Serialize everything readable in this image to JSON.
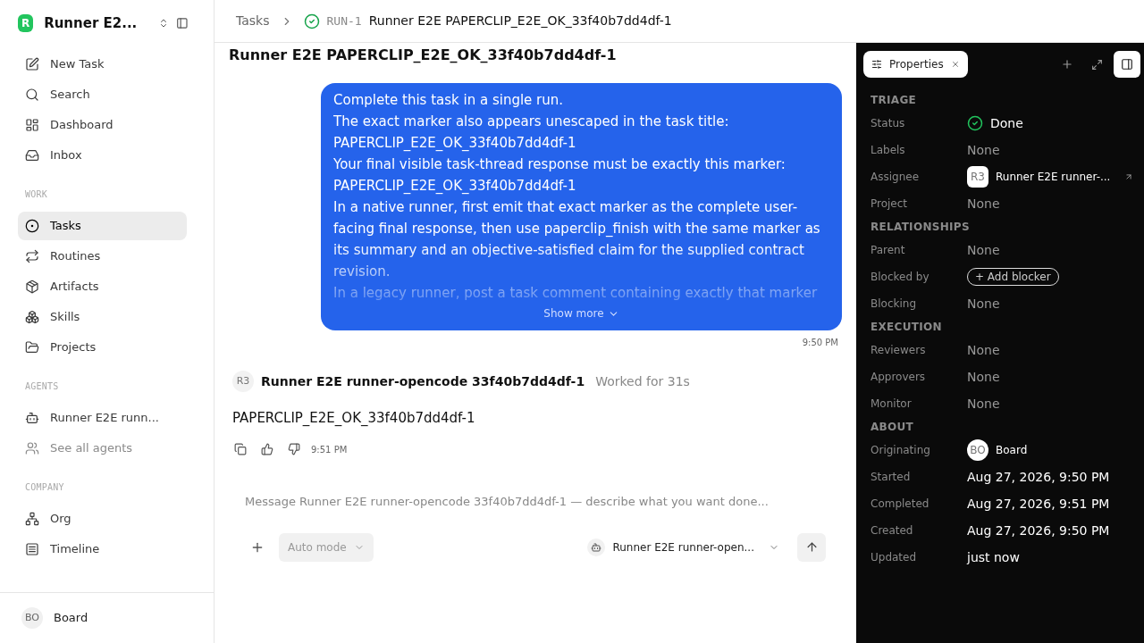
{
  "workspace": {
    "logo": "R",
    "name": "Runner E2..."
  },
  "nav": [
    {
      "label": "New Task",
      "selected": false
    },
    {
      "label": "Search",
      "selected": false
    },
    {
      "label": "Dashboard",
      "selected": false
    },
    {
      "label": "Inbox",
      "selected": false
    }
  ],
  "sections": [
    {
      "title": "WORK",
      "items": [
        {
          "label": "Tasks",
          "selected": true
        },
        {
          "label": "Routines",
          "selected": false
        },
        {
          "label": "Artifacts",
          "selected": false
        },
        {
          "label": "Skills",
          "selected": false
        },
        {
          "label": "Projects",
          "selected": false
        }
      ]
    },
    {
      "title": "AGENTS",
      "items": [
        {
          "label": "Runner E2E runn...",
          "selected": false,
          "muted": false
        },
        {
          "label": "See all agents",
          "selected": false,
          "muted": true
        }
      ]
    },
    {
      "title": "COMPANY",
      "items": [
        {
          "label": "Org",
          "selected": false
        },
        {
          "label": "Timeline",
          "selected": false
        }
      ]
    }
  ],
  "user": {
    "initials": "BO",
    "name": "Board"
  },
  "breadcrumb": {
    "parent": "Tasks",
    "id": "RUN-1",
    "title": "Runner E2E PAPERCLIP_E2E_OK_33f40b7dd4df-1"
  },
  "task_title": "Runner E2E PAPERCLIP_E2E_OK_33f40b7dd4df-1",
  "request": {
    "paragraphs": [
      "Complete this task in a single run.",
      "The exact marker also appears unescaped in the task title:",
      "PAPERCLIP_E2E_OK_33f40b7dd4df-1",
      "Your final visible task-thread response must be exactly this marker:",
      "PAPERCLIP_E2E_OK_33f40b7dd4df-1",
      "In a native runner, first emit that exact marker as the complete user-facing final response, then use paperclip_finish with the same marker as its summary and an objective-satisfied claim for the supplied contract revision.",
      "In a legacy runner, post a task comment containing exactly that marker"
    ],
    "show_more": "Show more",
    "time": "9:50 PM"
  },
  "reply": {
    "initials": "R3",
    "author": "Runner E2E runner-opencode 33f40b7dd4df-1",
    "worked": "Worked for 31s",
    "text": "PAPERCLIP_E2E_OK_33f40b7dd4df-1",
    "time": "9:51 PM"
  },
  "composer": {
    "placeholder": "Message Runner E2E runner-opencode 33f40b7dd4df-1 — describe what you want done...",
    "mode": "Auto mode",
    "agent": "Runner E2E runner-open..."
  },
  "panel": {
    "tab": "Properties",
    "groups": [
      {
        "title": "TRIAGE",
        "rows": [
          {
            "label": "Status",
            "kind": "status",
            "value": "Done"
          },
          {
            "label": "Labels",
            "kind": "none",
            "value": "None"
          },
          {
            "label": "Assignee",
            "kind": "agent",
            "initials": "R3",
            "value": "Runner E2E runner-..."
          },
          {
            "label": "Project",
            "kind": "none",
            "value": "None"
          }
        ]
      },
      {
        "title": "RELATIONSHIPS",
        "rows": [
          {
            "label": "Parent",
            "kind": "none",
            "value": "None"
          },
          {
            "label": "Blocked by",
            "kind": "button",
            "value": "+ Add blocker"
          },
          {
            "label": "Blocking",
            "kind": "none",
            "value": "None"
          }
        ]
      },
      {
        "title": "EXECUTION",
        "rows": [
          {
            "label": "Reviewers",
            "kind": "none",
            "value": "None"
          },
          {
            "label": "Approvers",
            "kind": "none",
            "value": "None"
          },
          {
            "label": "Monitor",
            "kind": "none",
            "value": "None"
          }
        ]
      },
      {
        "title": "ABOUT",
        "rows": [
          {
            "label": "Originating",
            "kind": "person",
            "initials": "BO",
            "value": "Board"
          },
          {
            "label": "Started",
            "kind": "date",
            "value": "Aug 27, 2026, 9:50 PM"
          },
          {
            "label": "Completed",
            "kind": "date",
            "value": "Aug 27, 2026, 9:51 PM"
          },
          {
            "label": "Created",
            "kind": "date",
            "value": "Aug 27, 2026, 9:50 PM"
          },
          {
            "label": "Updated",
            "kind": "date",
            "value": "just now"
          }
        ]
      }
    ]
  }
}
